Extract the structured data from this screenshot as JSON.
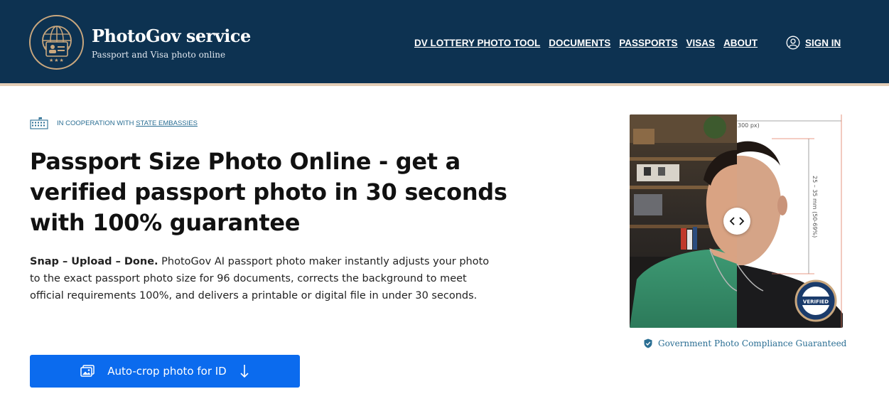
{
  "header": {
    "brand_title": "PhotoGov service",
    "brand_subtitle": "Passport and Visa photo online",
    "logo_stars": "★★★",
    "nav": [
      {
        "label": "DV LOTTERY PHOTO TOOL"
      },
      {
        "label": "DOCUMENTS"
      },
      {
        "label": "PASSPORTS"
      },
      {
        "label": "VISAS"
      },
      {
        "label": "ABOUT"
      }
    ],
    "sign_in": "SIGN IN",
    "colors": {
      "background": "#0d3251",
      "accent": "#c9a77e",
      "border": "#e3cdb6"
    }
  },
  "hero": {
    "cooperation_prefix": "IN COOPERATION WITH",
    "cooperation_link": "STATE EMBASSIES",
    "headline_bold": "Passport Size Photo Online",
    "headline_rest": " - get a verified passport photo in 30 seconds with 100% guarantee",
    "description_bold": "Snap – Upload – Done.",
    "description_rest": " PhotoGov AI passport photo maker instantly adjusts your photo to the exact passport photo size for 96 documents, corrects the background to meet official requirements 100%, and delivers a printable or digital file in under 30 seconds.",
    "cta_label": "Auto-crop photo for ID",
    "cta_color": "#0b6bee"
  },
  "photo": {
    "width_label": "300 px)",
    "height_label": "25 – 35 mm (50-69%)",
    "badge_text": "VERIFIED",
    "compliance_text": "Government Photo Compliance Guaranteed"
  },
  "icons": {
    "logo": "globe-id-card-icon",
    "sign_in": "user-icon",
    "embassy": "embassy-building-icon",
    "cta_image": "image-icon",
    "cta_arrow": "arrow-down-icon",
    "compare": "chevron-left-right-icon",
    "compliance": "shield-check-icon"
  }
}
